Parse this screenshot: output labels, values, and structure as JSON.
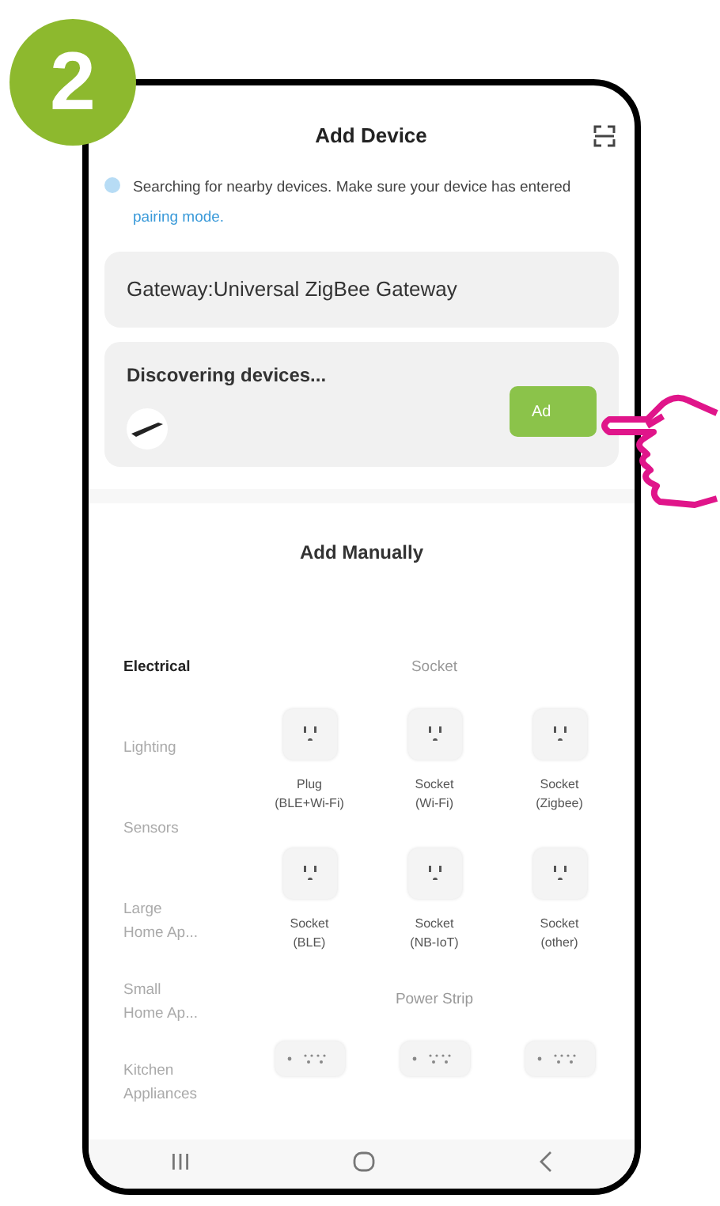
{
  "badge": "2",
  "header": {
    "title": "Add Device"
  },
  "notice": {
    "text": "Searching for nearby devices. Make sure your device has entered ",
    "link": "pairing mode."
  },
  "gateway": "Gateway:Universal ZigBee Gateway",
  "discovery": {
    "title": "Discovering devices...",
    "button": "Ad"
  },
  "manual": {
    "title": "Add Manually",
    "categories": [
      {
        "label": "Electrical",
        "selected": true
      },
      {
        "label": "Lighting",
        "selected": false
      },
      {
        "label": "Sensors",
        "selected": false
      },
      {
        "label": "Large Home Ap...",
        "selected": false
      },
      {
        "label": "Small Home Ap...",
        "selected": false
      },
      {
        "label": "Kitchen Appliances",
        "selected": false
      }
    ],
    "sections": [
      {
        "title": "Socket",
        "items": [
          {
            "kind": "socket",
            "label": "Plug\n(BLE+Wi-Fi)"
          },
          {
            "kind": "socket",
            "label": "Socket\n(Wi-Fi)"
          },
          {
            "kind": "socket",
            "label": "Socket\n(Zigbee)"
          },
          {
            "kind": "socket",
            "label": "Socket\n(BLE)"
          },
          {
            "kind": "socket",
            "label": "Socket\n(NB-IoT)"
          },
          {
            "kind": "socket",
            "label": "Socket\n(other)"
          }
        ]
      },
      {
        "title": "Power Strip",
        "items": [
          {
            "kind": "strip"
          },
          {
            "kind": "strip"
          },
          {
            "kind": "strip"
          }
        ]
      }
    ]
  }
}
